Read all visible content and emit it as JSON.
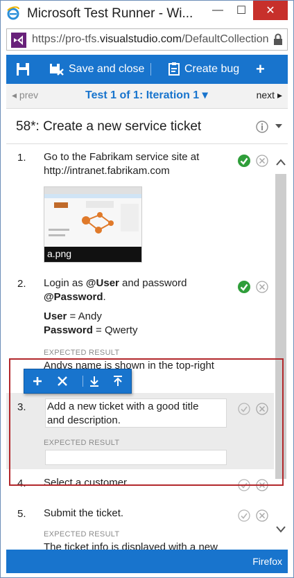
{
  "window": {
    "title": "Microsoft Test Runner - Wi...",
    "min_label": "—",
    "max_label": "☐",
    "close_label": "✕"
  },
  "address": {
    "url_prefix": "https://pro-tfs.",
    "url_domain": "visualstudio.com",
    "url_path": "/DefaultCollection"
  },
  "toolbar": {
    "save_close_label": "Save and close",
    "create_bug_label": "Create bug",
    "add_label": "+"
  },
  "nav": {
    "prev_label": "◂ prev",
    "iteration_label": "Test 1 of 1: Iteration 1 ▾",
    "next_label": "next ▸"
  },
  "test_case": {
    "title": "58*: Create a new service ticket"
  },
  "steps": [
    {
      "number": "1.",
      "text_line1": "Go to the Fabrikam service site at",
      "text_line2": "http://intranet.fabrikam.com",
      "attachment": "a.png",
      "status": "passed"
    },
    {
      "number": "2.",
      "text_pre": "Login as ",
      "text_user_param": "@User",
      "text_mid": " and password",
      "text_password_param": "@Password",
      "text_end": ".",
      "user_label": "User",
      "user_value": " = Andy",
      "password_label": "Password",
      "password_value": " = Qwerty",
      "expected_label": "EXPECTED RESULT",
      "expected_text": "Andys name is shown in the top-right",
      "status": "passed"
    },
    {
      "number": "3.",
      "text_line1": "Add a new ticket with a good title",
      "text_line2": "and description.",
      "expected_label": "EXPECTED RESULT",
      "expected_text": "",
      "status": "not-run"
    },
    {
      "number": "4.",
      "text": "Select a customer.",
      "status": "not-run"
    },
    {
      "number": "5.",
      "text": "Submit the ticket.",
      "expected_label": "EXPECTED RESULT",
      "expected_text": "The ticket info is displayed with a new",
      "status": "not-run"
    }
  ],
  "floating_toolbar": {
    "insert_label": "+",
    "delete_label": "✕",
    "move_down_label": "⤓",
    "move_up_label": "⤒"
  },
  "status_bar": {
    "browser": "Firefox"
  },
  "colors": {
    "accent": "#1874cd",
    "pass": "#2f9e3a",
    "highlight": "#b2272b",
    "close": "#c7302b"
  }
}
